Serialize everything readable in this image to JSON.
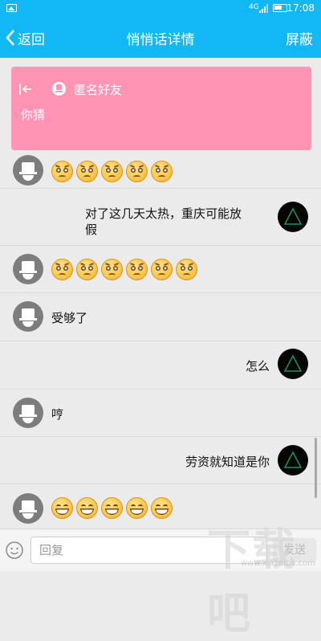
{
  "status_bar": {
    "network": "4G",
    "time": "17:08"
  },
  "nav": {
    "back_label": "返回",
    "title": "悄悄话详情",
    "right_action": "屏蔽"
  },
  "card": {
    "title": "匿名好友",
    "text": "你猜"
  },
  "messages": [
    {
      "side": "left",
      "type": "emoji",
      "count": 5,
      "emoji": "sorrow-face-icon"
    },
    {
      "side": "right",
      "type": "text",
      "line1": "对了这几天太热，重庆可能放",
      "line2": "假"
    },
    {
      "side": "left",
      "type": "emoji",
      "count": 6,
      "emoji": "sorrow-face-icon"
    },
    {
      "side": "left",
      "type": "text",
      "text": "受够了"
    },
    {
      "side": "right",
      "type": "text",
      "text": "怎么"
    },
    {
      "side": "left",
      "type": "text",
      "text": "哼"
    },
    {
      "side": "right",
      "type": "text",
      "text": "劳资就知道是你"
    },
    {
      "side": "left",
      "type": "emoji",
      "count": 5,
      "emoji": "grin-face-icon"
    }
  ],
  "input": {
    "placeholder": "回复",
    "send_label": "发送",
    "emoji_button": "smile-icon"
  },
  "watermark": {
    "text": "下载吧",
    "url": "www.xiazaiba.com"
  },
  "colors": {
    "header": "#12b7f5",
    "card": "#ff94b4",
    "background": "#ebebeb"
  }
}
